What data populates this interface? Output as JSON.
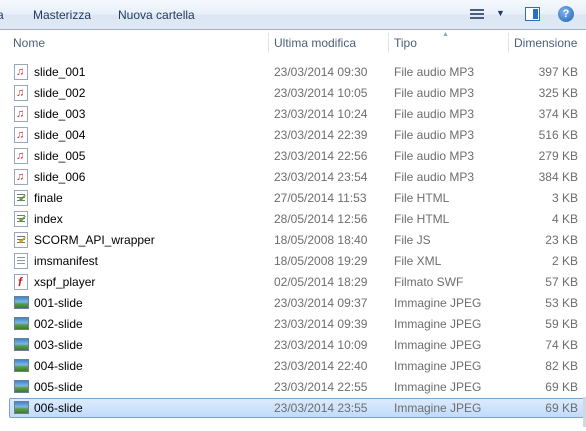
{
  "toolbar": {
    "cut_label": "a",
    "burn_label": "Masterizza",
    "new_folder_label": "Nuova cartella",
    "help_label": "?"
  },
  "columns": {
    "name": "Nome",
    "date": "Ultima modifica",
    "type": "Tipo",
    "size": "Dimensione"
  },
  "files": [
    {
      "name": "slide_001",
      "date": "23/03/2014 09:30",
      "type": "File audio MP3",
      "size": "397 KB",
      "icon": "mp3-audio-icon"
    },
    {
      "name": "slide_002",
      "date": "23/03/2014 10:05",
      "type": "File audio MP3",
      "size": "325 KB",
      "icon": "mp3-audio-icon"
    },
    {
      "name": "slide_003",
      "date": "23/03/2014 10:24",
      "type": "File audio MP3",
      "size": "374 KB",
      "icon": "mp3-audio-icon"
    },
    {
      "name": "slide_004",
      "date": "23/03/2014 22:39",
      "type": "File audio MP3",
      "size": "516 KB",
      "icon": "mp3-audio-icon"
    },
    {
      "name": "slide_005",
      "date": "23/03/2014 22:56",
      "type": "File audio MP3",
      "size": "279 KB",
      "icon": "mp3-audio-icon"
    },
    {
      "name": "slide_006",
      "date": "23/03/2014 23:54",
      "type": "File audio MP3",
      "size": "384 KB",
      "icon": "mp3-audio-icon"
    },
    {
      "name": "finale",
      "date": "27/05/2014 11:53",
      "type": "File HTML",
      "size": "3 KB",
      "icon": "html-file-icon"
    },
    {
      "name": "index",
      "date": "28/05/2014 12:56",
      "type": "File HTML",
      "size": "4 KB",
      "icon": "html-file-icon"
    },
    {
      "name": "SCORM_API_wrapper",
      "date": "18/05/2008 18:40",
      "type": "File JS",
      "size": "23 KB",
      "icon": "js-file-icon"
    },
    {
      "name": "imsmanifest",
      "date": "18/05/2008 19:29",
      "type": "File XML",
      "size": "2 KB",
      "icon": "xml-file-icon"
    },
    {
      "name": "xspf_player",
      "date": "02/05/2014 18:29",
      "type": "Filmato SWF",
      "size": "57 KB",
      "icon": "swf-file-icon"
    },
    {
      "name": "001-slide",
      "date": "23/03/2014 09:37",
      "type": "Immagine JPEG",
      "size": "53 KB",
      "icon": "jpeg-image-icon"
    },
    {
      "name": "002-slide",
      "date": "23/03/2014 09:39",
      "type": "Immagine JPEG",
      "size": "59 KB",
      "icon": "jpeg-image-icon"
    },
    {
      "name": "003-slide",
      "date": "23/03/2014 10:09",
      "type": "Immagine JPEG",
      "size": "74 KB",
      "icon": "jpeg-image-icon"
    },
    {
      "name": "004-slide",
      "date": "23/03/2014 22:40",
      "type": "Immagine JPEG",
      "size": "82 KB",
      "icon": "jpeg-image-icon"
    },
    {
      "name": "005-slide",
      "date": "23/03/2014 22:55",
      "type": "Immagine JPEG",
      "size": "69 KB",
      "icon": "jpeg-image-icon"
    },
    {
      "name": "006-slide",
      "date": "23/03/2014 23:55",
      "type": "Immagine JPEG",
      "size": "69 KB",
      "icon": "jpeg-image-icon",
      "selected": true
    }
  ]
}
